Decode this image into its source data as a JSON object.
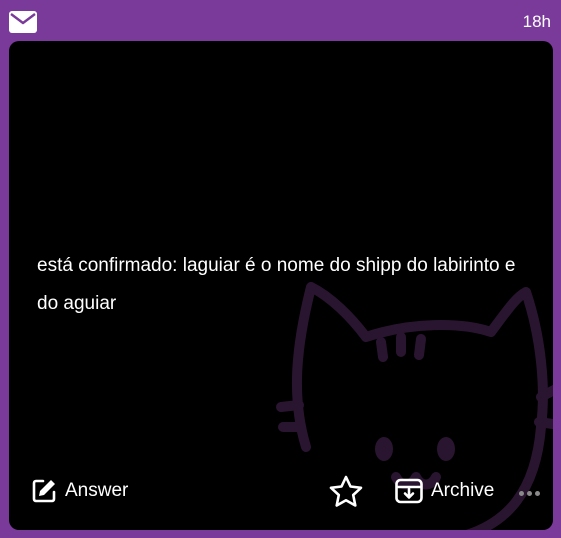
{
  "header": {
    "icon": "envelope-icon",
    "age": "18h"
  },
  "question": {
    "text": "está confirmado: laguiar é o nome do shipp do labirinto e do aguiar"
  },
  "actions": {
    "answer_label": "Answer",
    "archive_label": "Archive",
    "icons": [
      "edit-icon",
      "star-icon",
      "archive-icon",
      "more-dots-icon"
    ]
  },
  "colors": {
    "frame": "#7a3a9a",
    "card": "#000000",
    "text": "#ffffff",
    "cat_outline": "#2a1530"
  }
}
